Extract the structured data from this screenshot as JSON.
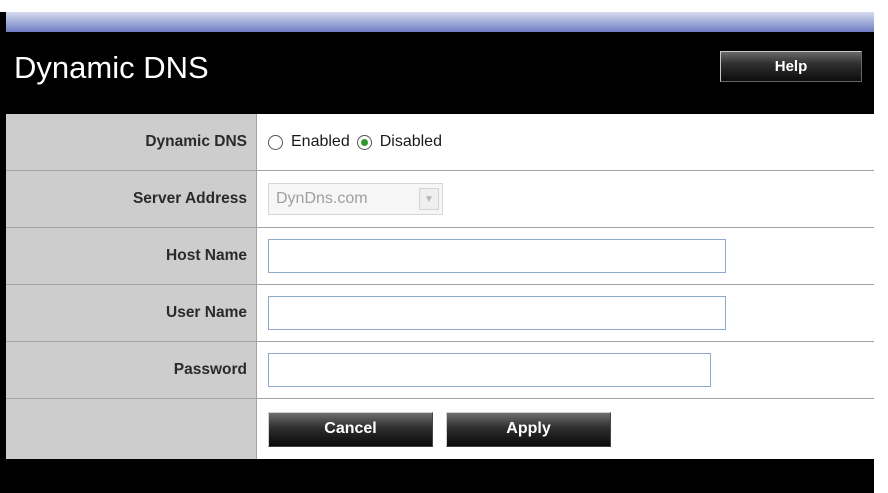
{
  "page": {
    "title": "Dynamic DNS",
    "help_label": "Help"
  },
  "form": {
    "dynamic_dns": {
      "label": "Dynamic DNS",
      "option_enabled": "Enabled",
      "option_disabled": "Disabled",
      "selected": "Disabled"
    },
    "server_address": {
      "label": "Server Address",
      "value": "DynDns.com",
      "disabled": true
    },
    "host_name": {
      "label": "Host Name",
      "value": ""
    },
    "user_name": {
      "label": "User Name",
      "value": ""
    },
    "password": {
      "label": "Password",
      "value": ""
    }
  },
  "buttons": {
    "cancel": "Cancel",
    "apply": "Apply"
  },
  "colors": {
    "header_bg": "#000000",
    "label_bg": "#cdcdcd",
    "radio_selected": "#2e9a2e",
    "input_border": "#8fa9c8"
  },
  "icons": {
    "dropdown": "chevron-down-icon",
    "radio_selected": "radio-selected-icon",
    "radio_unselected": "radio-unselected-icon"
  }
}
